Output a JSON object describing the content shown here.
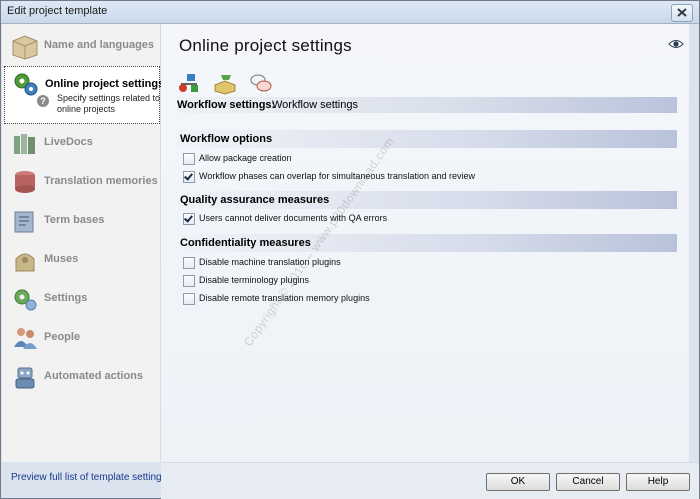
{
  "window": {
    "title": "Edit project template"
  },
  "sidebar": {
    "items": [
      {
        "label": "Name and languages",
        "icon": "box-icon"
      },
      {
        "label": "Online project settings",
        "icon": "gears-network-icon",
        "description": "Specify settings related to online projects"
      },
      {
        "label": "LiveDocs",
        "icon": "books-icon"
      },
      {
        "label": "Translation memories",
        "icon": "tm-icon"
      },
      {
        "label": "Term bases",
        "icon": "termbase-icon"
      },
      {
        "label": "Muses",
        "icon": "muse-icon"
      },
      {
        "label": "Settings",
        "icon": "settings-icon"
      },
      {
        "label": "People",
        "icon": "people-icon"
      },
      {
        "label": "Automated actions",
        "icon": "automation-icon"
      }
    ],
    "preview_link": "Preview full list of template settings"
  },
  "content": {
    "title": "Online project settings",
    "workflow_settings_label": "Workflow settings:",
    "workflow_settings_value": "Workflow settings",
    "sections": {
      "workflow_options": {
        "title": "Workflow options",
        "items": [
          {
            "label": "Allow package creation",
            "checked": false
          },
          {
            "label": "Workflow phases can overlap for simultaneous translation and review",
            "checked": true
          }
        ]
      },
      "qa": {
        "title": "Quality assurance measures",
        "items": [
          {
            "label": "Users cannot deliver documents with QA errors",
            "checked": true
          }
        ]
      },
      "confidentiality": {
        "title": "Confidentiality measures",
        "items": [
          {
            "label": "Disable machine translation plugins",
            "checked": false
          },
          {
            "label": "Disable terminology plugins",
            "checked": false
          },
          {
            "label": "Disable remote translation memory plugins",
            "checked": false
          }
        ]
      }
    },
    "watermark": "Copyright © 2016 – www.p30download.com"
  },
  "buttons": {
    "ok": "OK",
    "cancel": "Cancel",
    "help": "Help"
  }
}
